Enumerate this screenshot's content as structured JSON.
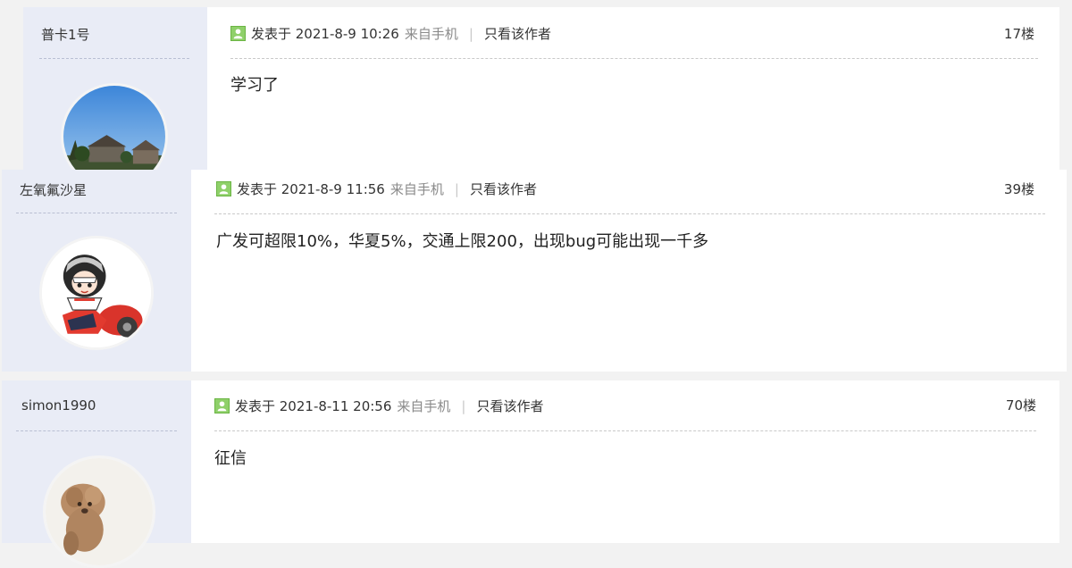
{
  "posts": [
    {
      "username": "普卡1号",
      "posted_at": "发表于 2021-8-9 10:26",
      "source": "来自手机",
      "author_only": "只看该作者",
      "floor": "17楼",
      "content": "学习了",
      "avatar": "landscape-avatar"
    },
    {
      "username": "左氧氟沙星",
      "posted_at": "发表于 2021-8-9 11:56",
      "source": "来自手机",
      "author_only": "只看该作者",
      "floor": "39楼",
      "content": "广发可超限10%，华夏5%，交通上限200，出现bug可能出现一千多",
      "avatar": "motorcycle-girl-avatar"
    },
    {
      "username": "simon1990",
      "posted_at": "发表于 2021-8-11 20:56",
      "source": "来自手机",
      "author_only": "只看该作者",
      "floor": "70楼",
      "content": "征信",
      "avatar": "poodle-avatar"
    }
  ],
  "icons": {
    "status": "online-user-icon",
    "separator": "|"
  },
  "colors": {
    "sidebar_bg": "#e9ecf6",
    "main_bg": "#ffffff",
    "status_green": "#8fd06a",
    "muted_text": "#8a8a8a"
  }
}
